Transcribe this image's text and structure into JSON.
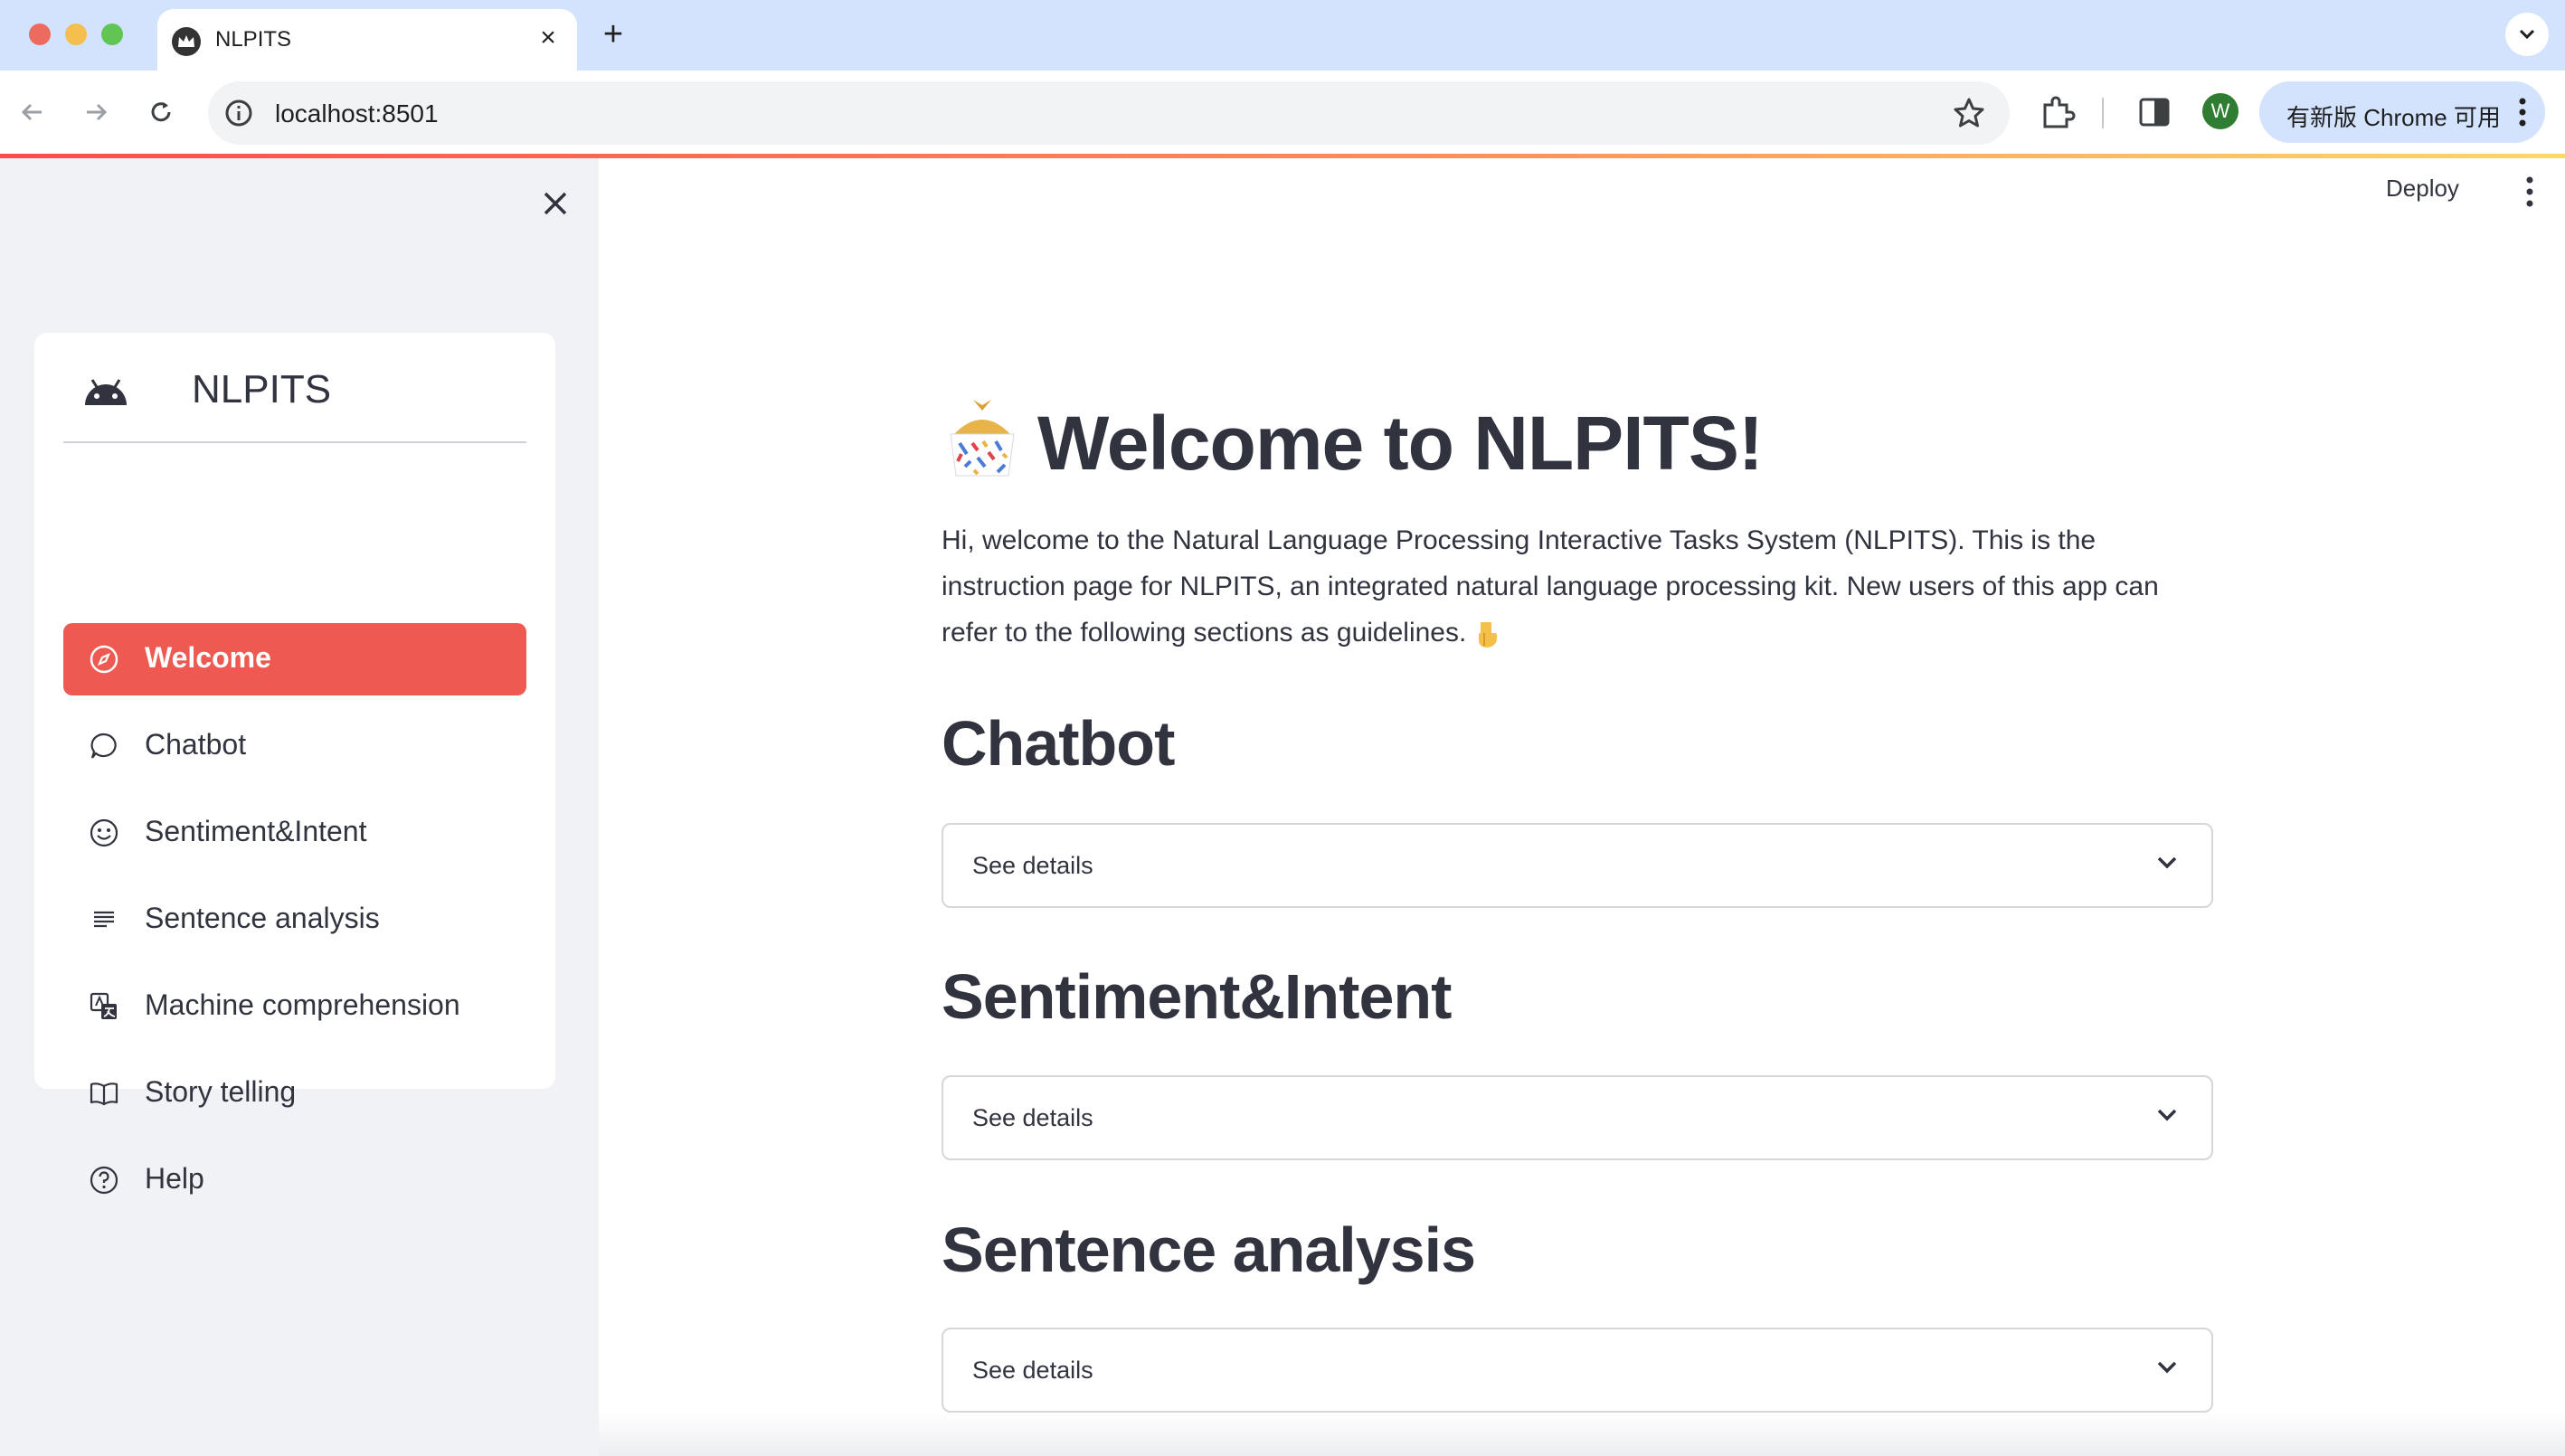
{
  "browser": {
    "tab_title": "NLPITS",
    "url": "localhost:8501",
    "update_button": "有新版 Chrome 可用",
    "profile_initial": "W"
  },
  "app": {
    "deploy_label": "Deploy"
  },
  "sidebar": {
    "brand": "NLPITS",
    "items": [
      {
        "label": "Welcome",
        "icon": "compass-icon",
        "active": true
      },
      {
        "label": "Chatbot",
        "icon": "chat-bubble-icon",
        "active": false
      },
      {
        "label": "Sentiment&Intent",
        "icon": "smiley-icon",
        "active": false
      },
      {
        "label": "Sentence analysis",
        "icon": "text-lines-icon",
        "active": false
      },
      {
        "label": "Machine comprehension",
        "icon": "translate-icon",
        "active": false
      },
      {
        "label": "Story telling",
        "icon": "open-book-icon",
        "active": false
      },
      {
        "label": "Help",
        "icon": "question-circle-icon",
        "active": false
      }
    ]
  },
  "main": {
    "title": "Welcome to NLPITS!",
    "intro": "Hi, welcome to the Natural Language Processing Interactive Tasks System (NLPITS). This is the instruction page for NLPITS, an integrated natural language processing kit. New users of this app can refer to the following sections as guidelines.",
    "sections": [
      {
        "title": "Chatbot",
        "expander": "See details"
      },
      {
        "title": "Sentiment&Intent",
        "expander": "See details"
      },
      {
        "title": "Sentence analysis",
        "expander": "See details"
      }
    ]
  },
  "colors": {
    "accent": "#ee5a52",
    "sidebar_bg": "#f0f2f6",
    "tabbar_bg": "#d3e3fd",
    "text": "#31333f"
  }
}
